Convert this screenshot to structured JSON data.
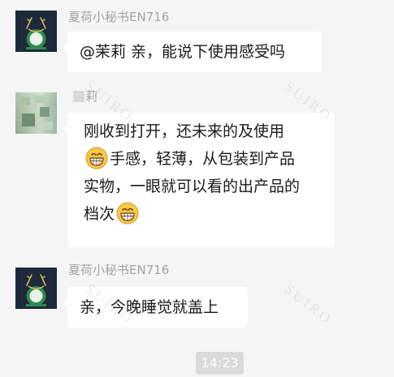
{
  "messages": [
    {
      "sender": "夏荷小秘书EN716",
      "avatar_icon": "brand-logo-avatar",
      "text": "@茉莉 亲，能说下使用感受吗"
    },
    {
      "sender": "莉",
      "avatar_icon": "blurred-user-avatar",
      "lines": [
        "刚收到打开，还未来的及使用",
        "手感，轻薄，从包装到产品",
        "实物，一眼就可以看的出产品的",
        "档次"
      ],
      "emoji": "grinning-face-emoji"
    },
    {
      "sender": "夏荷小秘书EN716",
      "avatar_icon": "brand-logo-avatar",
      "text": "亲，今晚睡觉就盖上"
    }
  ],
  "time_divider": "14:23",
  "watermark": "SUIRO",
  "colors": {
    "background": "#f5f5f5",
    "bubble": "#ffffff",
    "sender_name": "#a4a4a4",
    "time_badge": "#dadada",
    "emoji_face": "#f7c84a"
  }
}
